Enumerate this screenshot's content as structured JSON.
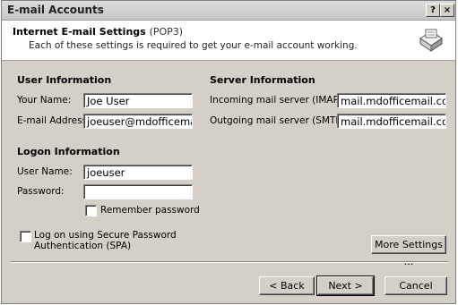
{
  "window": {
    "title": "E-mail Accounts",
    "help_label": "?",
    "close_label": "×"
  },
  "header": {
    "title": "Internet E-mail Settings",
    "protocol": "(POP3)",
    "description": "Each of these settings is required to get your e-mail account working."
  },
  "user_info": {
    "heading": "User Information",
    "name_label": "Your Name:",
    "name_value": "Joe User",
    "email_label": "E-mail Address:",
    "email_value": "joeuser@mdofficemai"
  },
  "server_info": {
    "heading": "Server Information",
    "incoming_label": "Incoming mail server (IMAP):",
    "incoming_value": "mail.mdofficemail.com",
    "outgoing_label": "Outgoing mail server (SMTP):",
    "outgoing_value": "mail.mdofficemail.com"
  },
  "logon_info": {
    "heading": "Logon Information",
    "username_label": "User Name:",
    "username_value": "joeuser",
    "password_label": "Password:",
    "password_value": "",
    "remember_label": "Remember password",
    "spa_label_line1": "Log on using Secure Password",
    "spa_label_line2": "Authentication (SPA)"
  },
  "buttons": {
    "more_settings": "More Settings ...",
    "back": "< Back",
    "next": "Next >",
    "cancel": "Cancel"
  },
  "icons": {
    "header_icon": "mail-settings-icon"
  }
}
